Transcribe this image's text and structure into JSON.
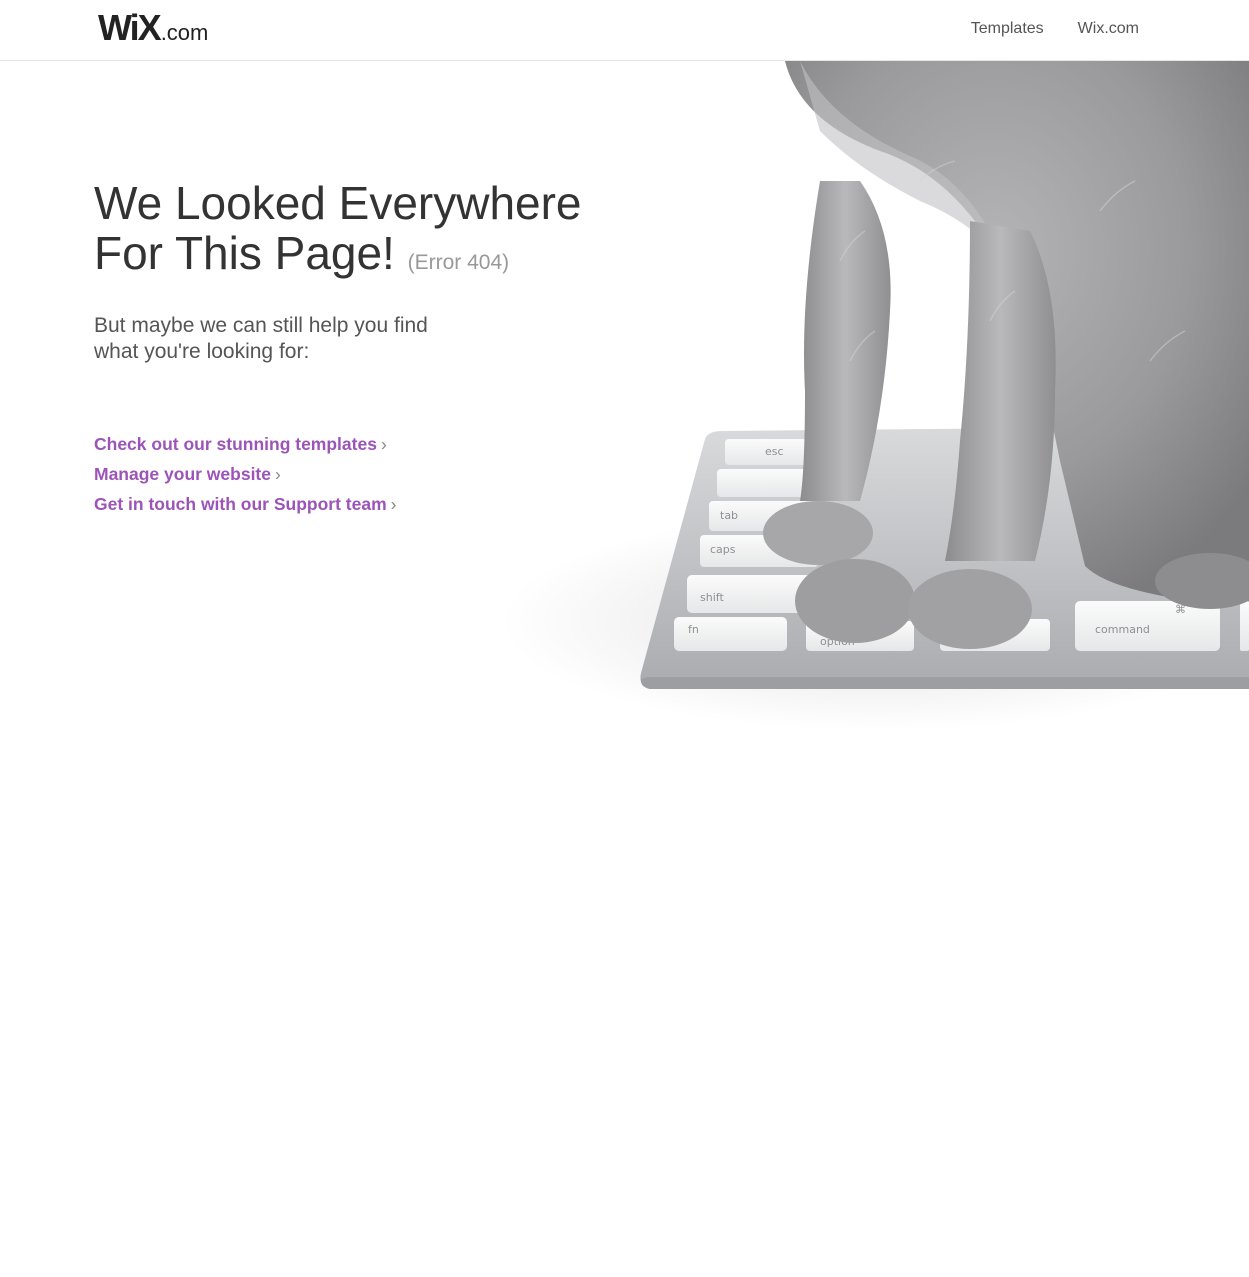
{
  "header": {
    "logo": {
      "mark": "WiX",
      "suffix": ".com"
    },
    "nav": [
      {
        "label": "Templates"
      },
      {
        "label": "Wix.com"
      }
    ]
  },
  "main": {
    "headline_line1": "We Looked Everywhere",
    "headline_line2": "For This Page!",
    "error_code": "(Error 404)",
    "subtext": "But maybe we can still help you find what you're looking for:",
    "links": [
      {
        "label": "Check out our stunning templates",
        "chevron": "›"
      },
      {
        "label": "Manage your website",
        "chevron": "›"
      },
      {
        "label": "Get in touch with our Support team",
        "chevron": "›"
      }
    ]
  },
  "illustration": {
    "keys": [
      "esc",
      "tab",
      "caps",
      "shift",
      "fn",
      "option",
      "command",
      "⌘"
    ]
  },
  "colors": {
    "link": "#9c54b8",
    "logo_dot": "#fbbd29",
    "text": "#333333",
    "muted": "#999999"
  }
}
